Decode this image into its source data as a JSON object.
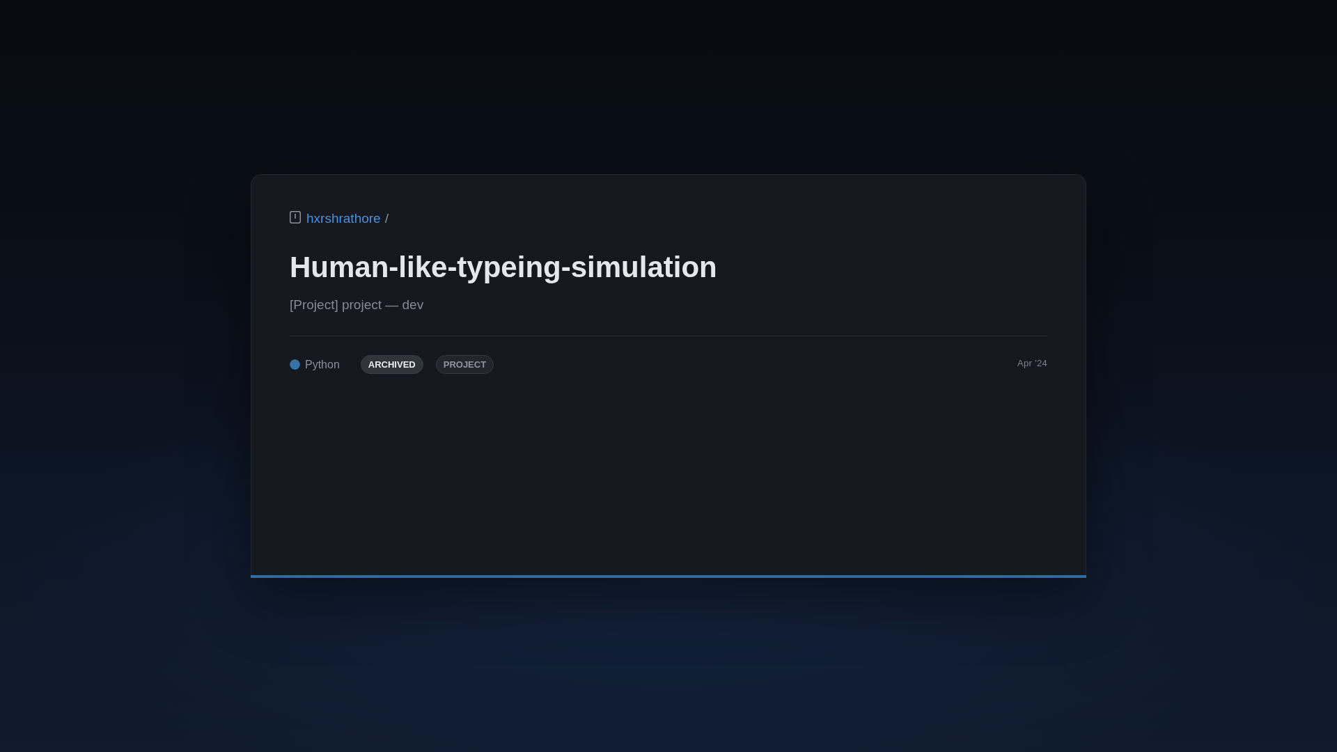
{
  "breadcrumb": {
    "owner": "hxrshrathore",
    "separator": "/"
  },
  "title": "Human-like-typeing-simulation",
  "description": "[Project] project — dev",
  "footer": {
    "language": {
      "name": "Python",
      "color": "#3572a5"
    },
    "tags": [
      {
        "label": "ARCHIVED",
        "kind": "status"
      },
      {
        "label": "PROJECT",
        "kind": "type"
      }
    ],
    "date": "Apr '24"
  }
}
